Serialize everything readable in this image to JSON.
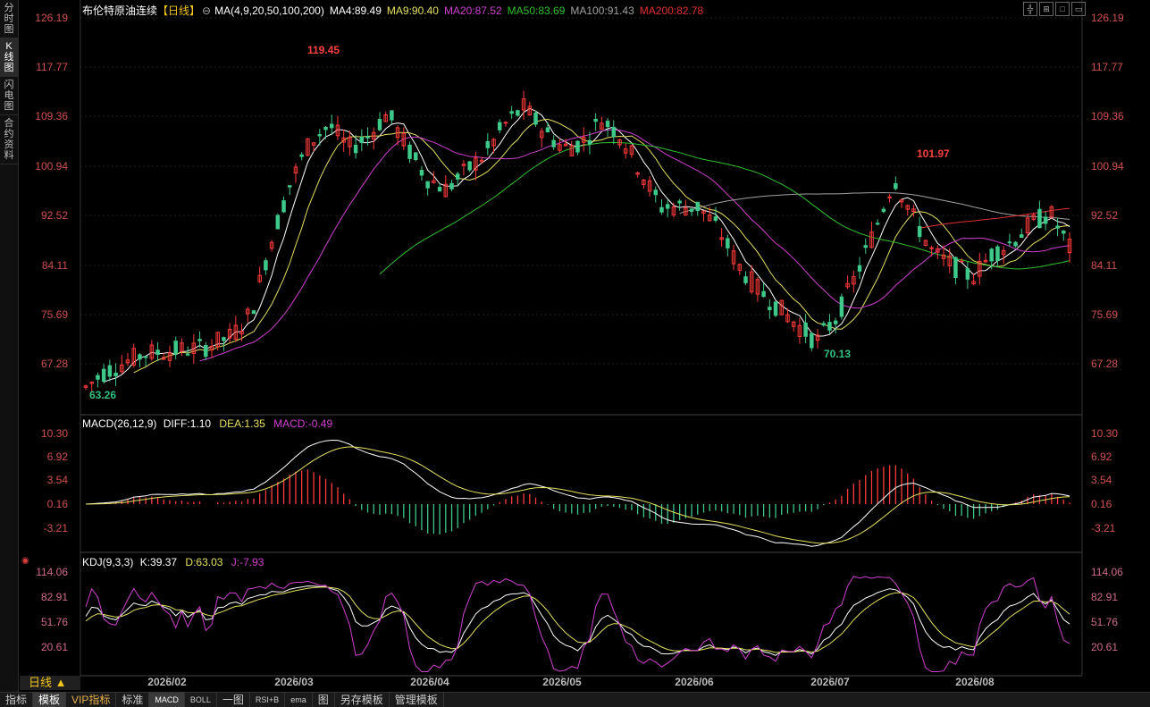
{
  "sidebar": {
    "tabs": [
      {
        "label": "分\n时\n图",
        "active": false
      },
      {
        "label": "K\n线\n图",
        "active": true
      },
      {
        "label": "闪\n电\n图",
        "active": false
      },
      {
        "label": "合\n约\n资\n料",
        "active": false
      }
    ]
  },
  "main_chart": {
    "instrument": "布伦特原油连续",
    "period_tag": "【日线】",
    "ma_header": "MA(4,9,20,50,100,200)",
    "ma": [
      {
        "label": "MA4:89.49",
        "color": "#ffffff"
      },
      {
        "label": "MA9:90.40",
        "color": "#e5e060"
      },
      {
        "label": "MA20:87.52",
        "color": "#d040d0"
      },
      {
        "label": "MA50:83.69",
        "color": "#30c030"
      },
      {
        "label": "MA100:91.43",
        "color": "#a0a0a0"
      },
      {
        "label": "MA200:82.78",
        "color": "#e03030"
      }
    ],
    "price_ticks": [
      "126.19",
      "117.77",
      "109.36",
      "100.94",
      "92.52",
      "84.11",
      "75.69",
      "67.28"
    ],
    "annotations": [
      {
        "text": "119.45",
        "color": "#ff4040"
      },
      {
        "text": "101.97",
        "color": "#ff4040"
      },
      {
        "text": "70.13",
        "color": "#30c080"
      },
      {
        "text": "63.26",
        "color": "#30c080"
      }
    ]
  },
  "macd": {
    "header": "MACD(26,12,9)",
    "diff": "DIFF:1.10",
    "dea": "DEA:1.35",
    "macd": "MACD:-0.49",
    "colors": {
      "diff": "#ffffff",
      "dea": "#e5e060",
      "macd": "#d040d0"
    },
    "ticks": [
      "10.30",
      "6.92",
      "3.54",
      "0.16",
      "-3.21"
    ]
  },
  "kdj": {
    "header": "KDJ(9,3,3)",
    "k": "K:39.37",
    "d": "D:63.03",
    "j": "J:-7.93",
    "colors": {
      "k": "#ffffff",
      "d": "#e5e060",
      "j": "#d040d0"
    },
    "ticks": [
      "114.06",
      "82.91",
      "51.76",
      "20.61"
    ]
  },
  "dates": [
    "2026/02",
    "2026/03",
    "2026/04",
    "2026/05",
    "2026/06",
    "2026/07",
    "2026/08"
  ],
  "period_button": "日线 ▲",
  "bottom_tabs": [
    {
      "label": "指标",
      "style": ""
    },
    {
      "label": "模板",
      "style": "active"
    },
    {
      "label": "VIP指标",
      "style": "vip"
    },
    {
      "label": "标准",
      "style": ""
    },
    {
      "label": "MACD",
      "style": "active small"
    },
    {
      "label": "BOLL",
      "style": "small"
    },
    {
      "label": "一图",
      "style": ""
    },
    {
      "label": "RSI+B",
      "style": "small"
    },
    {
      "label": "ema",
      "style": "small"
    },
    {
      "label": "图",
      "style": ""
    },
    {
      "label": "另存模板",
      "style": ""
    },
    {
      "label": "管理模板",
      "style": ""
    }
  ],
  "toolbar_icons": [
    "grid-icon",
    "layout-icon",
    "maximize-icon",
    "window-icon"
  ]
}
